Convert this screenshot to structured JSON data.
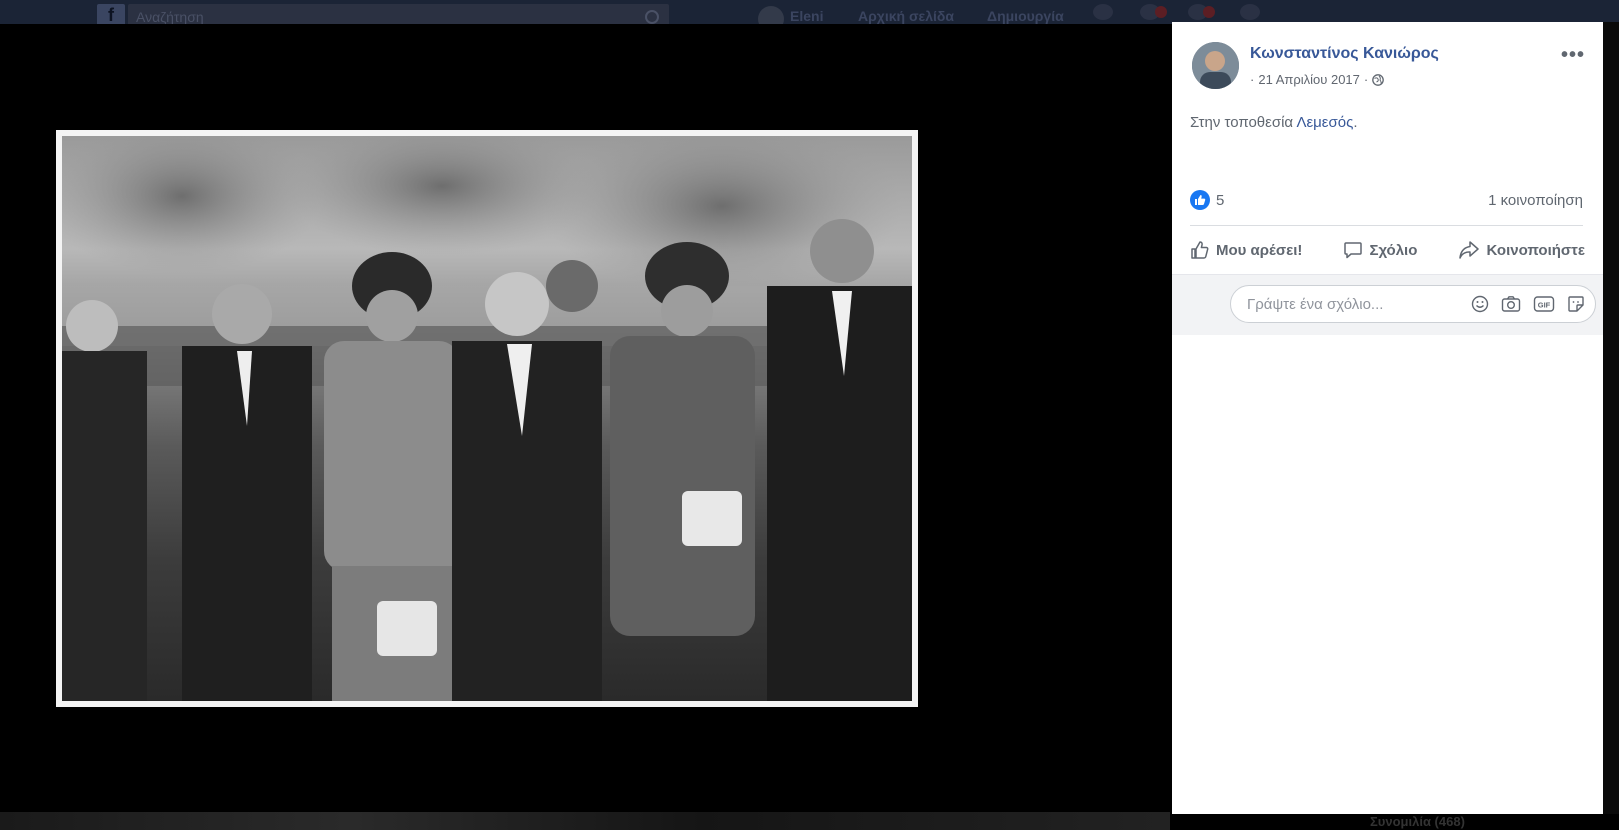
{
  "topbar": {
    "search_placeholder": "Αναζήτηση",
    "nav_home": "Eleni",
    "nav_start": "Αρχική σελίδα",
    "nav_create": "Δημιουργία"
  },
  "post": {
    "author": "Κωνσταντίνος Κανιώρος",
    "date": "21 Απριλίου 2017",
    "location_prefix": "Στην τοποθεσία ",
    "location_name": "Λεμεσός",
    "location_suffix": ".",
    "likes": "5",
    "shares": "1 κοινοποίηση",
    "actions": {
      "like": "Μου αρέσει!",
      "comment": "Σχόλιο",
      "share": "Κοινοποιήστε"
    },
    "comment_placeholder": "Γράψτε ένα σχόλιο..."
  },
  "bottom_right": "Συνομιλία (468)",
  "colors": {
    "link": "#385898",
    "like_blue": "#1877f2",
    "muted": "#606770"
  }
}
